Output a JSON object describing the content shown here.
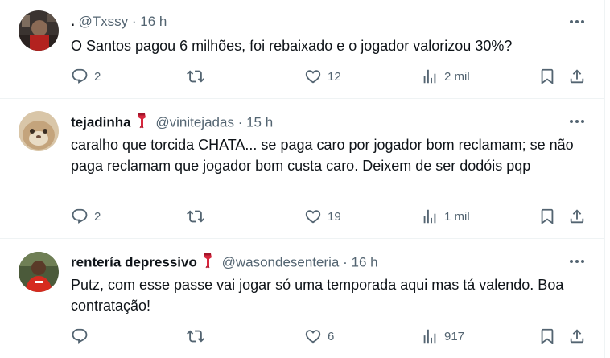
{
  "tweets": [
    {
      "name": ".",
      "handle": "@Txssy",
      "sep": "·",
      "time": "16 h",
      "text": "O Santos pagou 6 milhões, foi rebaixado e o jogador valorizou 30%?",
      "replies": "2",
      "retweets": "",
      "likes": "12",
      "views": "2 mil"
    },
    {
      "name": "tejadinha",
      "handle": "@vinitejadas",
      "sep": "·",
      "time": "15 h",
      "text": "caralho que torcida CHATA... se paga caro por jogador bom reclamam; se não paga reclamam que jogador bom custa caro. Deixem de ser dodóis pqp",
      "replies": "2",
      "retweets": "",
      "likes": "19",
      "views": "1 mil"
    },
    {
      "name": "rentería depressivo",
      "handle": "@wasondesenteria",
      "sep": "·",
      "time": "16 h",
      "text": "Putz, com esse passe vai jogar só uma temporada aqui mas tá valendo. Boa contratação!",
      "replies": "",
      "retweets": "",
      "likes": "6",
      "views": "917"
    }
  ],
  "icons": {
    "more": "more-icon",
    "reply": "reply-icon",
    "retweet": "retweet-icon",
    "like": "heart-icon",
    "views": "views-icon",
    "bookmark": "bookmark-icon",
    "share": "share-icon",
    "badge": "red-scarf-emoji"
  },
  "colors": {
    "text": "#0f1419",
    "secondary": "#536471",
    "divider": "#eff3f4",
    "badge": "#d7263d"
  }
}
